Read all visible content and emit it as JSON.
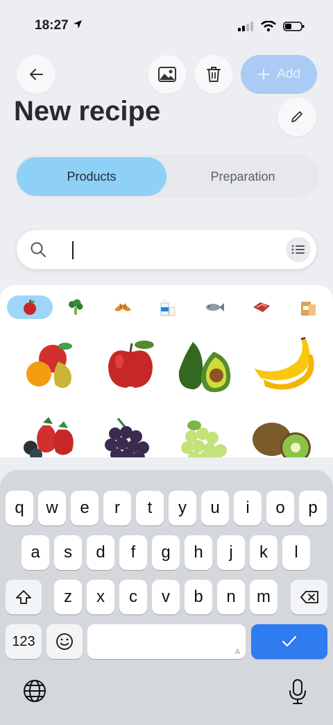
{
  "status": {
    "time": "18:27"
  },
  "header": {
    "add_label": "Add",
    "title": "New recipe"
  },
  "tabs": [
    {
      "label": "Products",
      "active": true
    },
    {
      "label": "Preparation",
      "active": false
    }
  ],
  "search": {
    "value": "",
    "placeholder": ""
  },
  "categories": [
    {
      "icon": "apple-icon",
      "selected": true
    },
    {
      "icon": "broccoli-icon",
      "selected": false
    },
    {
      "icon": "croissant-icon",
      "selected": false
    },
    {
      "icon": "milk-carton-icon",
      "selected": false
    },
    {
      "icon": "fish-icon",
      "selected": false
    },
    {
      "icon": "meat-icon",
      "selected": false
    },
    {
      "icon": "grocery-bag-icon",
      "selected": false
    }
  ],
  "products": [
    {
      "icon": "mixed-fruits-icon"
    },
    {
      "icon": "apple-icon"
    },
    {
      "icon": "avocado-icon"
    },
    {
      "icon": "banana-icon"
    },
    {
      "icon": "berries-icon"
    },
    {
      "icon": "grapes-icon"
    },
    {
      "icon": "green-grapes-icon"
    },
    {
      "icon": "kiwi-icon"
    }
  ],
  "keyboard": {
    "row1": [
      "q",
      "w",
      "e",
      "r",
      "t",
      "y",
      "u",
      "i",
      "o",
      "p"
    ],
    "row2": [
      "a",
      "s",
      "d",
      "f",
      "g",
      "h",
      "j",
      "k",
      "l"
    ],
    "row3": [
      "z",
      "x",
      "c",
      "v",
      "b",
      "n",
      "m"
    ],
    "numbers_label": "123",
    "space_hint": "A"
  },
  "colors": {
    "accent": "#8fd0f7",
    "add_button": "#a9cbf4",
    "confirm_key": "#2f7bf0"
  }
}
